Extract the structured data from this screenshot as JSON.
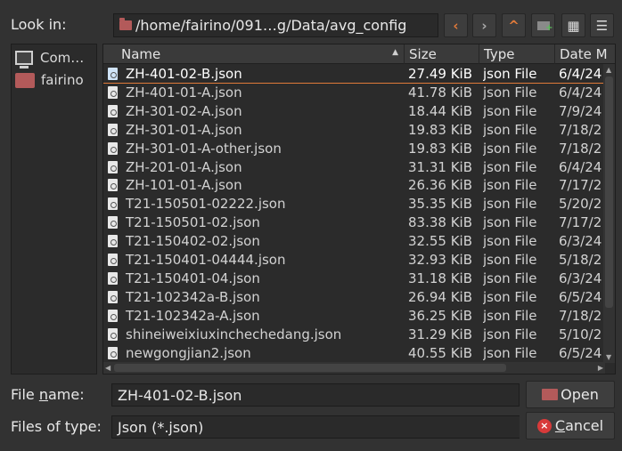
{
  "toolbar": {
    "look_in_label": "Look in:",
    "path": "/home/fairino/091…g/Data/avg_config",
    "back_icon": "‹",
    "forward_icon": "›",
    "up_icon": "^",
    "new_folder_icon": "+",
    "list_view_icon": "▦",
    "detail_view_icon": "☰"
  },
  "sidebar": {
    "items": [
      {
        "label": "Com…",
        "icon": "computer-icon"
      },
      {
        "label": "fairino",
        "icon": "home-folder-icon"
      }
    ]
  },
  "columns": [
    "Name",
    "Size",
    "Type",
    "Date M"
  ],
  "files": [
    {
      "name": "ZH-401-02-B.json",
      "size": "27.49 KiB",
      "type": "json File",
      "date": "6/4/24"
    },
    {
      "name": "ZH-401-01-A.json",
      "size": "41.78 KiB",
      "type": "json File",
      "date": "6/4/24"
    },
    {
      "name": "ZH-301-02-A.json",
      "size": "18.44 KiB",
      "type": "json File",
      "date": "7/9/24"
    },
    {
      "name": "ZH-301-01-A.json",
      "size": "19.83 KiB",
      "type": "json File",
      "date": "7/18/2"
    },
    {
      "name": "ZH-301-01-A-other.json",
      "size": "19.83 KiB",
      "type": "json File",
      "date": "7/18/2"
    },
    {
      "name": "ZH-201-01-A.json",
      "size": "31.31 KiB",
      "type": "json File",
      "date": "6/4/24"
    },
    {
      "name": "ZH-101-01-A.json",
      "size": "26.36 KiB",
      "type": "json File",
      "date": "7/17/2"
    },
    {
      "name": "T21-150501-02222.json",
      "size": "35.35 KiB",
      "type": "json File",
      "date": "5/20/2"
    },
    {
      "name": "T21-150501-02.json",
      "size": "83.38 KiB",
      "type": "json File",
      "date": "7/17/2"
    },
    {
      "name": "T21-150402-02.json",
      "size": "32.55 KiB",
      "type": "json File",
      "date": "6/3/24"
    },
    {
      "name": "T21-150401-04444.json",
      "size": "32.93 KiB",
      "type": "json File",
      "date": "5/18/2"
    },
    {
      "name": "T21-150401-04.json",
      "size": "31.18 KiB",
      "type": "json File",
      "date": "6/3/24"
    },
    {
      "name": "T21-102342a-B.json",
      "size": "26.94 KiB",
      "type": "json File",
      "date": "6/5/24"
    },
    {
      "name": "T21-102342a-A.json",
      "size": "36.25 KiB",
      "type": "json File",
      "date": "7/18/2"
    },
    {
      "name": "shineiweixiuxinchechedang.json",
      "size": "31.29 KiB",
      "type": "json File",
      "date": "5/10/2"
    },
    {
      "name": "newgongjian2.json",
      "size": "40.55 KiB",
      "type": "json File",
      "date": "6/5/24"
    }
  ],
  "selected_index": 0,
  "footer": {
    "file_name_label_pre": "File ",
    "file_name_label_u": "n",
    "file_name_label_post": "ame:",
    "file_name_value": "ZH-401-02-B.json",
    "file_type_label": "Files of type:",
    "file_type_value": "Json (*.json)",
    "open_label": "Open",
    "cancel_label_u": "C",
    "cancel_label_post": "ancel",
    "cancel_icon": "×"
  }
}
